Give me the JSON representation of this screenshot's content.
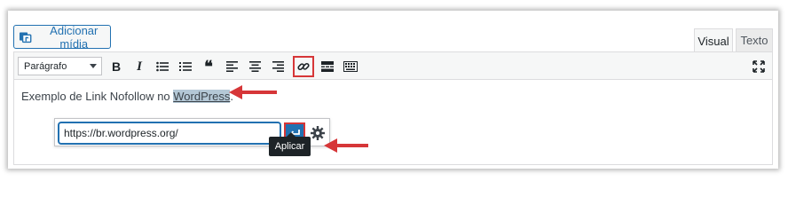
{
  "add_media": {
    "label": "Adicionar mídia"
  },
  "tabs": {
    "visual": "Visual",
    "text": "Texto"
  },
  "toolbar": {
    "format_select": "Parágrafo",
    "bold": "B",
    "italic": "I",
    "blockquote": "❝"
  },
  "content": {
    "text_before": "Exemplo de Link Nofollow no ",
    "linked_word": "WordPress",
    "text_after": "."
  },
  "link_popup": {
    "url_value": "https://br.wordpress.org/",
    "apply_tooltip": "Aplicar"
  },
  "colors": {
    "accent": "#2271b1",
    "highlight": "#d63638",
    "tooltip_bg": "#1d2327"
  },
  "icons": [
    "media-icon",
    "bullet-list-icon",
    "numbered-list-icon",
    "align-left-icon",
    "align-center-icon",
    "align-right-icon",
    "link-icon",
    "read-more-icon",
    "toolbar-toggle-icon",
    "fullscreen-icon",
    "apply-enter-icon",
    "gear-icon",
    "red-arrow-icon"
  ]
}
